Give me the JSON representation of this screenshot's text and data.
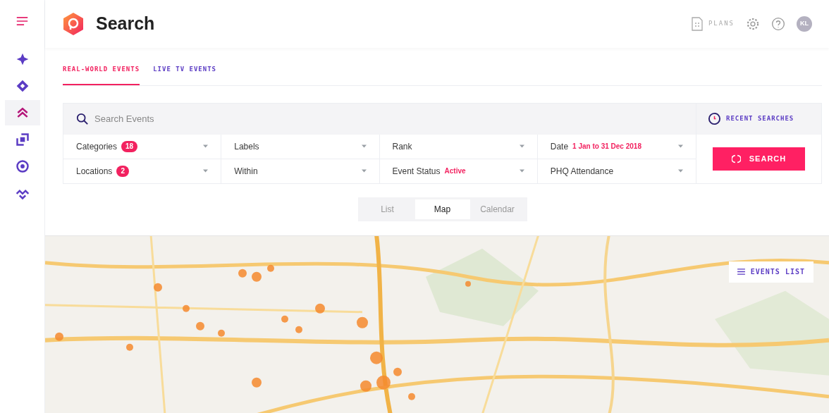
{
  "sidebar": {
    "items": [
      {
        "selected": false
      },
      {
        "selected": false
      },
      {
        "selected": true
      },
      {
        "selected": false
      },
      {
        "selected": false
      },
      {
        "selected": false
      }
    ]
  },
  "header": {
    "title": "Search",
    "plans": "PLANS",
    "avatar": "KL"
  },
  "tabs": [
    {
      "label": "REAL-WORLD EVENTS",
      "selected": true
    },
    {
      "label": "LIVE TV EVENTS",
      "selected": false
    }
  ],
  "search": {
    "placeholder": "Search Events",
    "recent": "RECENT SEARCHES",
    "button": "SEARCH"
  },
  "filters": [
    {
      "label": "Categories",
      "count": "18"
    },
    {
      "label": "Labels"
    },
    {
      "label": "Rank"
    },
    {
      "label": "Date",
      "value": "1 Jan to 31 Dec 2018"
    },
    {
      "label": "Locations",
      "count": "2"
    },
    {
      "label": "Within"
    },
    {
      "label": "Event Status",
      "value": "Active"
    },
    {
      "label": "PHQ Attendance"
    }
  ],
  "views": [
    {
      "label": "List",
      "selected": false
    },
    {
      "label": "Map",
      "selected": true
    },
    {
      "label": "Calendar",
      "selected": false
    }
  ],
  "map": {
    "kind": "picture",
    "events_list": "EVENTS LIST"
  }
}
